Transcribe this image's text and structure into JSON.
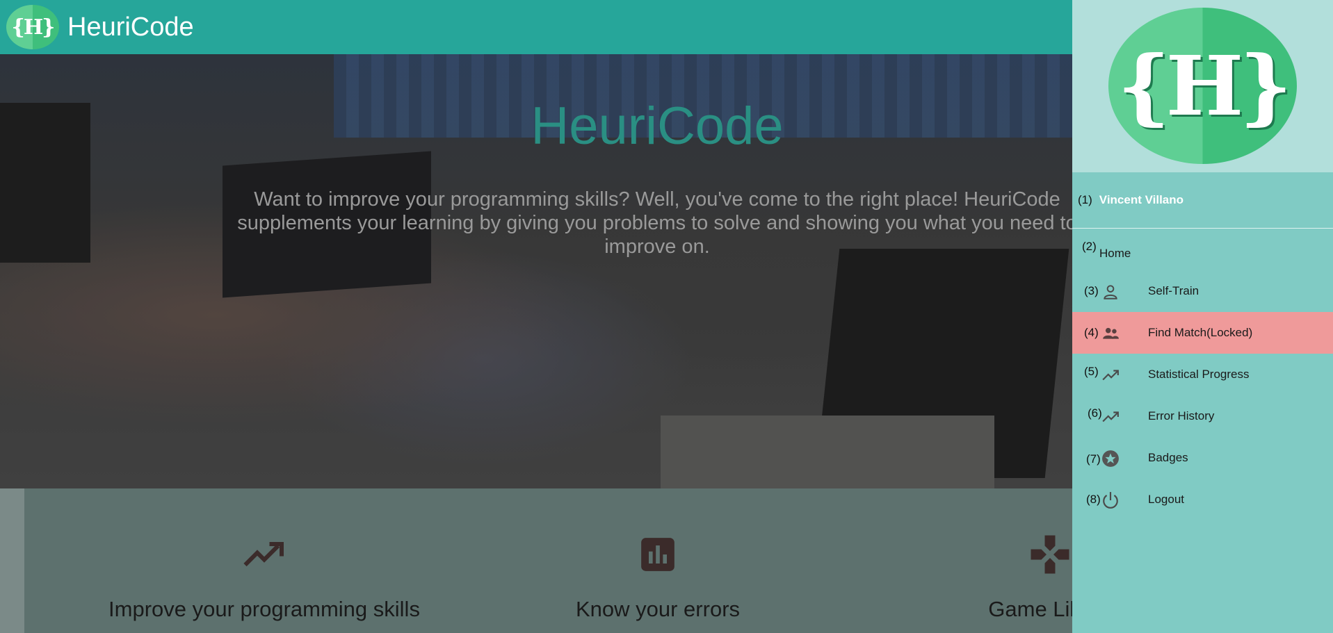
{
  "topbar": {
    "logo_text": "{H}",
    "brand": "HeuriCode"
  },
  "hero": {
    "title": "HeuriCode",
    "text": "Want to improve your programming skills? Well, you've come to the right place! HeuriCode supplements your learning by giving you problems to solve and showing you what you need to improve on."
  },
  "features": [
    {
      "icon": "trending-up-icon",
      "title": "Improve your programming skills"
    },
    {
      "icon": "bar-chart-icon",
      "title": "Know your errors"
    },
    {
      "icon": "gamepad-icon",
      "title": "Game Like F"
    }
  ],
  "sidenav": {
    "logo_text": "{H}",
    "user": {
      "num": "(1)",
      "name": "Vincent Villano"
    },
    "items": [
      {
        "num": "(2)",
        "label": "Home",
        "icon": ""
      },
      {
        "num": "(3)",
        "label": "Self-Train",
        "icon": "person-icon"
      },
      {
        "num": "(4)",
        "label": "Find Match(Locked)",
        "icon": "people-icon"
      },
      {
        "num": "(5)",
        "label": "Statistical Progress",
        "icon": "trending-up-icon"
      },
      {
        "num": "(6)",
        "label": "Error History",
        "icon": "trending-up-icon"
      },
      {
        "num": "(7)",
        "label": "Badges",
        "icon": "star-badge-icon"
      },
      {
        "num": "(8)",
        "label": "Logout",
        "icon": "power-icon"
      }
    ],
    "locked_color": "#ef9a9a"
  },
  "colors": {
    "primary": "#26a69a",
    "nav_bg": "#80cbc4",
    "nav_header_bg": "#b2dfdb"
  }
}
